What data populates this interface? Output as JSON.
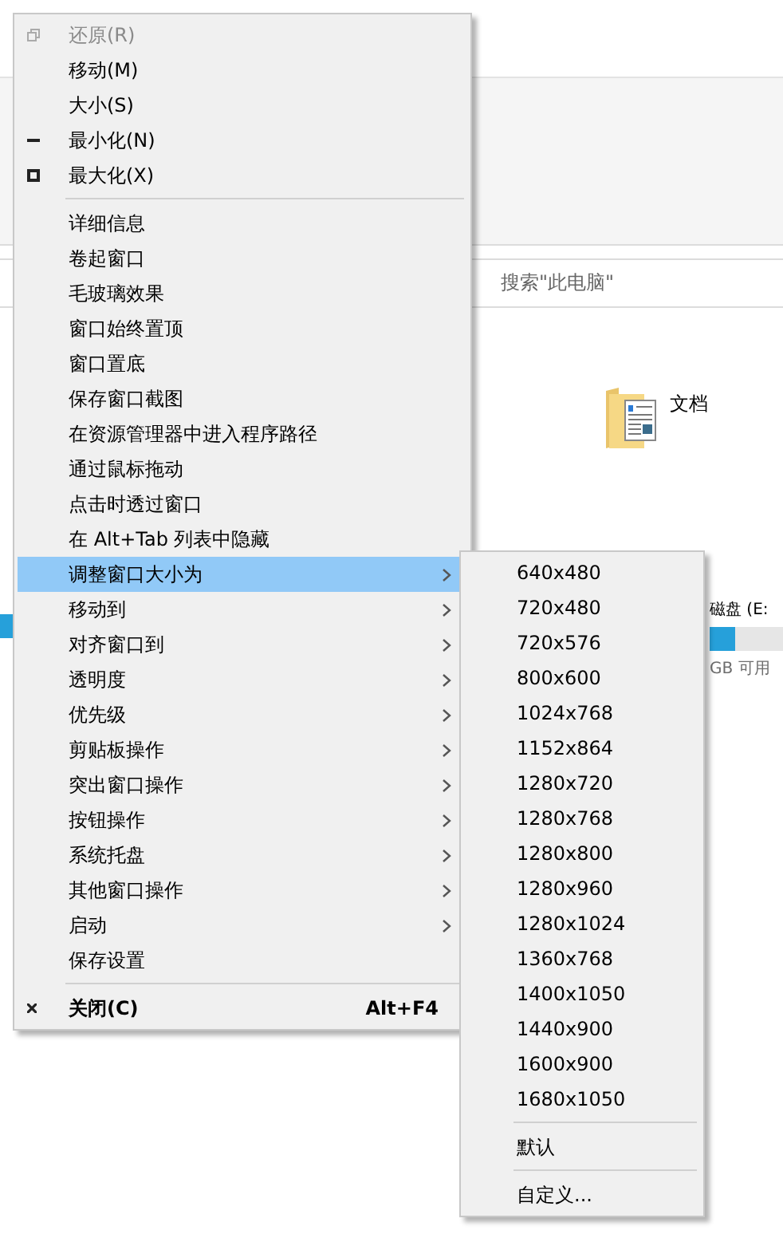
{
  "background": {
    "search_placeholder": "搜索\"此电脑\"",
    "folder": {
      "label": "文档"
    },
    "drive": {
      "label": "磁盘 (E:",
      "level": 0.35,
      "free": "GB 可用"
    }
  },
  "menu": {
    "items": [
      {
        "kind": "restore",
        "label": "还原(R)",
        "disabled": true
      },
      {
        "kind": "item",
        "label": "移动(M)"
      },
      {
        "kind": "item",
        "label": "大小(S)"
      },
      {
        "kind": "minimize",
        "label": "最小化(N)"
      },
      {
        "kind": "maximize",
        "label": "最大化(X)"
      },
      {
        "kind": "separator"
      },
      {
        "kind": "item",
        "label": "详细信息"
      },
      {
        "kind": "item",
        "label": "卷起窗口"
      },
      {
        "kind": "item",
        "label": "毛玻璃效果"
      },
      {
        "kind": "item",
        "label": "窗口始终置顶"
      },
      {
        "kind": "item",
        "label": "窗口置底"
      },
      {
        "kind": "item",
        "label": "保存窗口截图"
      },
      {
        "kind": "item",
        "label": "在资源管理器中进入程序路径"
      },
      {
        "kind": "item",
        "label": "通过鼠标拖动"
      },
      {
        "kind": "item",
        "label": "点击时透过窗口"
      },
      {
        "kind": "item",
        "label": "在 Alt+Tab 列表中隐藏"
      },
      {
        "kind": "item",
        "label": "调整窗口大小为",
        "submenu": true,
        "selected": true
      },
      {
        "kind": "item",
        "label": "移动到",
        "submenu": true,
        "selected": false
      },
      {
        "kind": "item",
        "label": "对齐窗口到",
        "submenu": true,
        "selected": false
      },
      {
        "kind": "item",
        "label": "透明度",
        "submenu": true,
        "selected": false
      },
      {
        "kind": "item",
        "label": "优先级",
        "submenu": true,
        "selected": false
      },
      {
        "kind": "item",
        "label": "剪贴板操作",
        "submenu": true,
        "selected": false
      },
      {
        "kind": "item",
        "label": "突出窗口操作",
        "submenu": true,
        "selected": false
      },
      {
        "kind": "item",
        "label": "按钮操作",
        "submenu": true,
        "selected": false
      },
      {
        "kind": "item",
        "label": "系统托盘",
        "submenu": true,
        "selected": false
      },
      {
        "kind": "item",
        "label": "其他窗口操作",
        "submenu": true,
        "selected": false
      },
      {
        "kind": "item",
        "label": "启动",
        "submenu": true,
        "selected": false
      },
      {
        "kind": "item",
        "label": "保存设置"
      },
      {
        "kind": "separator"
      },
      {
        "kind": "close",
        "label": "关闭(C)",
        "shortcut": "Alt+F4",
        "default": true
      }
    ]
  },
  "submenu": {
    "items": [
      {
        "kind": "item",
        "label": "640x480"
      },
      {
        "kind": "item",
        "label": "720x480"
      },
      {
        "kind": "item",
        "label": "720x576"
      },
      {
        "kind": "item",
        "label": "800x600"
      },
      {
        "kind": "item",
        "label": "1024x768"
      },
      {
        "kind": "item",
        "label": "1152x864"
      },
      {
        "kind": "item",
        "label": "1280x720"
      },
      {
        "kind": "item",
        "label": "1280x768"
      },
      {
        "kind": "item",
        "label": "1280x800"
      },
      {
        "kind": "item",
        "label": "1280x960"
      },
      {
        "kind": "item",
        "label": "1280x1024"
      },
      {
        "kind": "item",
        "label": "1360x768"
      },
      {
        "kind": "item",
        "label": "1400x1050"
      },
      {
        "kind": "item",
        "label": "1440x900"
      },
      {
        "kind": "item",
        "label": "1600x900"
      },
      {
        "kind": "item",
        "label": "1680x1050"
      },
      {
        "kind": "separator"
      },
      {
        "kind": "item",
        "label": "默认"
      },
      {
        "kind": "separator"
      },
      {
        "kind": "item",
        "label": "自定义..."
      }
    ]
  }
}
